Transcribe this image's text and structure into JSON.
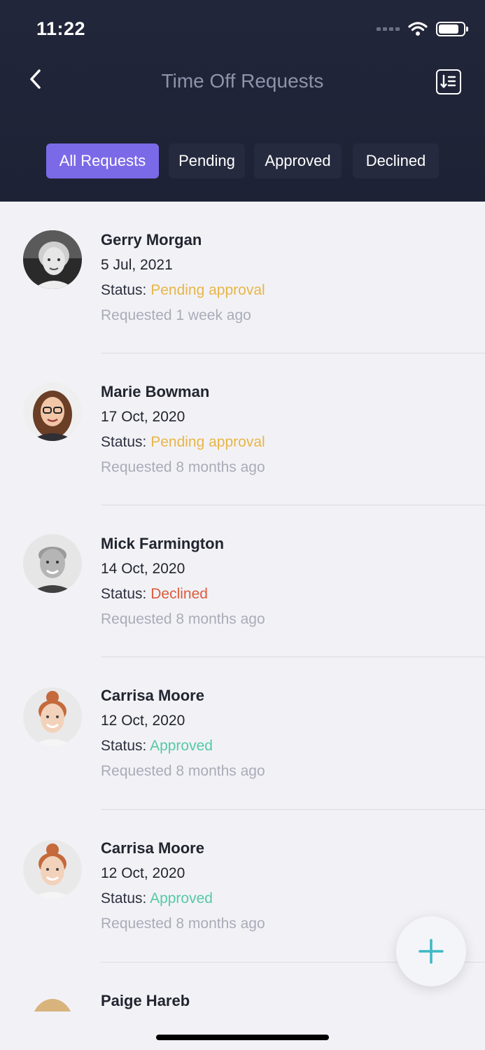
{
  "status_bar": {
    "time": "11:22"
  },
  "header": {
    "title": "Time Off Requests"
  },
  "tabs": [
    {
      "label": "All Requests",
      "active": true
    },
    {
      "label": "Pending",
      "active": false
    },
    {
      "label": "Approved",
      "active": false
    },
    {
      "label": "Declined",
      "active": false
    }
  ],
  "status_label": "Status:",
  "requests": [
    {
      "name": "Gerry Morgan",
      "date": "5 Jul, 2021",
      "status": "Pending approval",
      "status_color": "#e8b548",
      "requested": "Requested 1 week ago"
    },
    {
      "name": "Marie Bowman",
      "date": "17 Oct, 2020",
      "status": "Pending approval",
      "status_color": "#e8b548",
      "requested": "Requested 8 months ago"
    },
    {
      "name": "Mick Farmington",
      "date": "14 Oct, 2020",
      "status": "Declined",
      "status_color": "#dc5b3c",
      "requested": "Requested 8 months ago"
    },
    {
      "name": "Carrisa Moore",
      "date": "12 Oct, 2020",
      "status": "Approved",
      "status_color": "#56c9a2",
      "requested": "Requested 8 months ago"
    },
    {
      "name": "Carrisa Moore",
      "date": "12 Oct, 2020",
      "status": "Approved",
      "status_color": "#56c9a2",
      "requested": "Requested 8 months ago"
    },
    {
      "name": "Paige Hareb"
    }
  ],
  "colors": {
    "accent": "#7b6ae8",
    "header_bg": "#22263a",
    "fab_icon": "#3db8c4"
  },
  "icons": {
    "back": "chevron-left-icon",
    "sort": "sort-list-icon",
    "add": "plus-icon",
    "wifi": "wifi-icon",
    "battery": "battery-icon"
  }
}
